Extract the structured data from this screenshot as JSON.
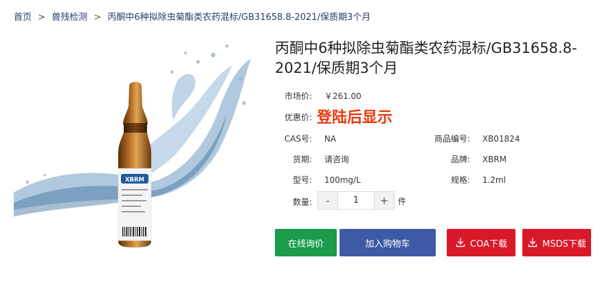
{
  "breadcrumb": {
    "home": "首页",
    "category": "兽残检测",
    "current": "丙酮中6种拟除虫菊酯类农药混标/GB31658.8-2021/保质期3个月",
    "separator": ">"
  },
  "product": {
    "title": "丙酮中6种拟除虫菊酯类农药混标/GB31658.8-2021/保质期3个月",
    "vial_brand_text": "XBRM",
    "market_price_label": "市场价:",
    "market_price": "￥261.00",
    "promo_price_label": "优惠价:",
    "promo_price": "登陆后显示",
    "cas_label": "CAS号:",
    "cas": "NA",
    "code_label": "商品编号:",
    "code": "XB01824",
    "delivery_label": "货期:",
    "delivery": "请咨询",
    "brand_label": "品牌:",
    "brand": "XBRM",
    "model_label": "型号:",
    "model": "100mg/L",
    "spec_label": "规格:",
    "spec": "1.2ml",
    "qty_label": "数量:",
    "qty": "1",
    "qty_minus": "-",
    "qty_plus": "+",
    "unit": "件"
  },
  "actions": {
    "inquiry": "在线询价",
    "add_cart": "加入购物车",
    "coa": "COA下载",
    "msds": "MSDS下载"
  },
  "colors": {
    "inquiry": "#1a9c4b",
    "add_cart": "#3f5aa4",
    "download": "#d8192a",
    "promo": "#e8380d",
    "breadcrumb": "#2b3a67"
  }
}
